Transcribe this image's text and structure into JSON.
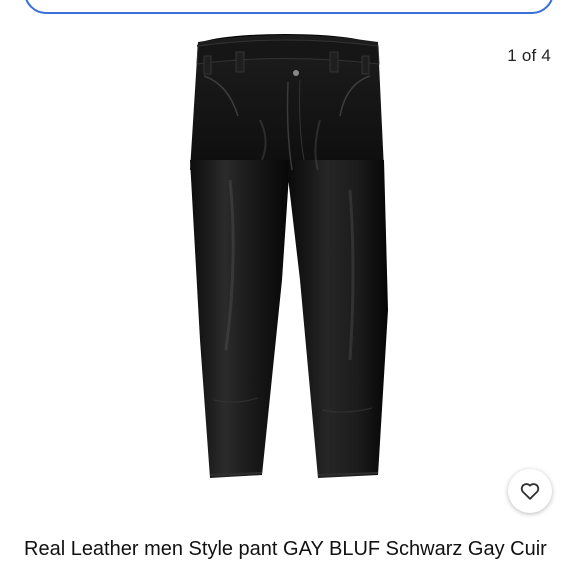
{
  "search": {
    "accent_color": "#3b6fd9"
  },
  "gallery": {
    "counter": "1 of 4",
    "image_subject": "black leather pants"
  },
  "listing": {
    "title": "Real Leather men  Style pant  GAY BLUF Schwarz Gay Cuir"
  },
  "actions": {
    "watch_icon": "heart-icon"
  }
}
